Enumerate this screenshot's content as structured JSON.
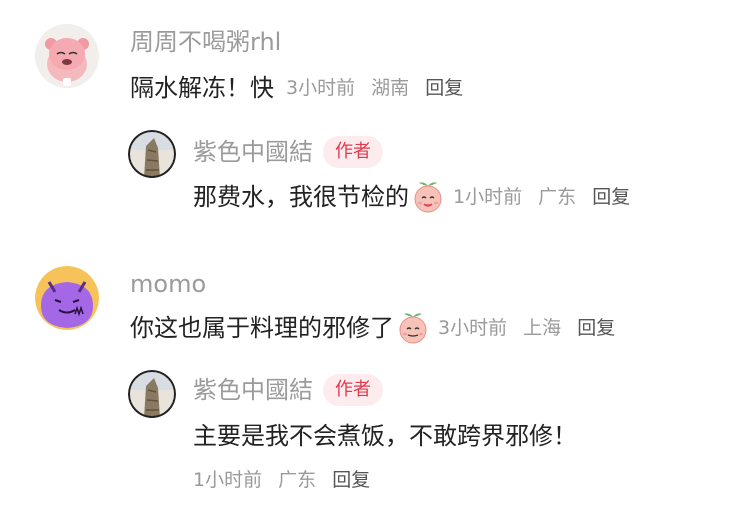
{
  "comments": [
    {
      "user": "周周不喝粥rhl",
      "text": "隔水解冻！快",
      "time": "3小时前",
      "location": "湖南",
      "reply_label": "回复"
    },
    {
      "user": "紫色中國結",
      "badge": "作者",
      "text": "那费水，我很节检的",
      "emoji_icon": "peach-face-emoji",
      "time": "1小时前",
      "location": "广东",
      "reply_label": "回复"
    },
    {
      "user": "momo",
      "text": "你这也属于料理的邪修了",
      "emoji_icon": "peach-face-emoji",
      "time": "3小时前",
      "location": "上海",
      "reply_label": "回复"
    },
    {
      "user": "紫色中國結",
      "badge": "作者",
      "text": "主要是我不会煮饭，不敢跨界邪修！",
      "time": "1小时前",
      "location": "广东",
      "reply_label": "回复"
    }
  ],
  "colors": {
    "badge_text": "#e03a4e",
    "badge_bg": "#fdecee",
    "name": "#9b9b9b",
    "meta": "#9a9a9a"
  }
}
